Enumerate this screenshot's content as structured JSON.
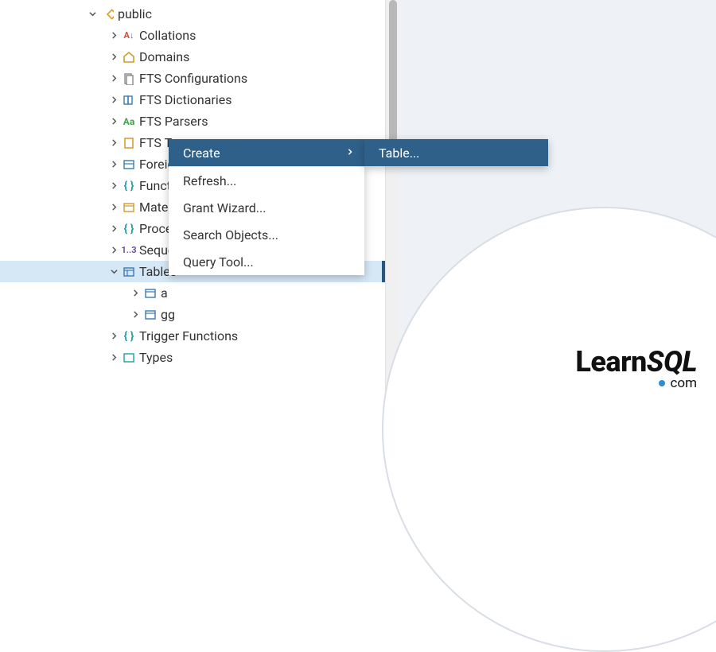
{
  "schema": {
    "name": "public"
  },
  "tree": {
    "collations": "Collations",
    "domains": "Domains",
    "fts_config": "FTS Configurations",
    "fts_dict": "FTS Dictionaries",
    "fts_parsers": "FTS Parsers",
    "fts_templates": "FTS T",
    "foreign": "Foreig",
    "functions": "Funct",
    "matviews": "Mater",
    "procedures": "Proce",
    "sequences": "Seque",
    "tables": "Tables",
    "trigger_funcs": "Trigger Functions",
    "types": "Types"
  },
  "tables_children": {
    "a": "a",
    "gg": "gg"
  },
  "context_menu": {
    "create": "Create",
    "refresh": "Refresh...",
    "grant_wizard": "Grant Wizard...",
    "search_objects": "Search Objects...",
    "query_tool": "Query Tool..."
  },
  "submenu": {
    "table": "Table..."
  },
  "logo": {
    "learn": "Learn",
    "sql": "SQL",
    "com": "com"
  }
}
